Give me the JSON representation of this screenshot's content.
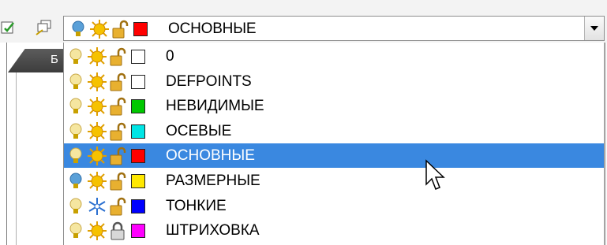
{
  "combo": {
    "current_layer": "ОСНОВНЫЕ",
    "color": "#ff0000",
    "icons": [
      "lightbulb-on-icon",
      "sun-icon",
      "unlock-icon"
    ]
  },
  "tab": {
    "label": "Б"
  },
  "layers": [
    {
      "name": "0",
      "color": "#ffffff",
      "bulb": "off",
      "freeze": "sun",
      "lock": "unlocked"
    },
    {
      "name": "DEFPOINTS",
      "color": "#ffffff",
      "bulb": "off",
      "freeze": "sun",
      "lock": "unlocked"
    },
    {
      "name": "НЕВИДИМЫЕ",
      "color": "#00c800",
      "bulb": "off",
      "freeze": "sun",
      "lock": "unlocked"
    },
    {
      "name": "ОСЕВЫЕ",
      "color": "#00e5e5",
      "bulb": "off",
      "freeze": "sun",
      "lock": "unlocked"
    },
    {
      "name": "ОСНОВНЫЕ",
      "color": "#ff0000",
      "bulb": "off",
      "freeze": "sun",
      "lock": "unlocked",
      "selected": true
    },
    {
      "name": "РАЗМЕРНЫЕ",
      "color": "#ffe800",
      "bulb": "on",
      "freeze": "sun",
      "lock": "unlocked"
    },
    {
      "name": "ТОНКИЕ",
      "color": "#0000ff",
      "bulb": "off",
      "freeze": "snowflake",
      "lock": "unlocked"
    },
    {
      "name": "ШТРИХОВКА",
      "color": "#ff00ff",
      "bulb": "off",
      "freeze": "sun",
      "lock": "locked"
    }
  ]
}
